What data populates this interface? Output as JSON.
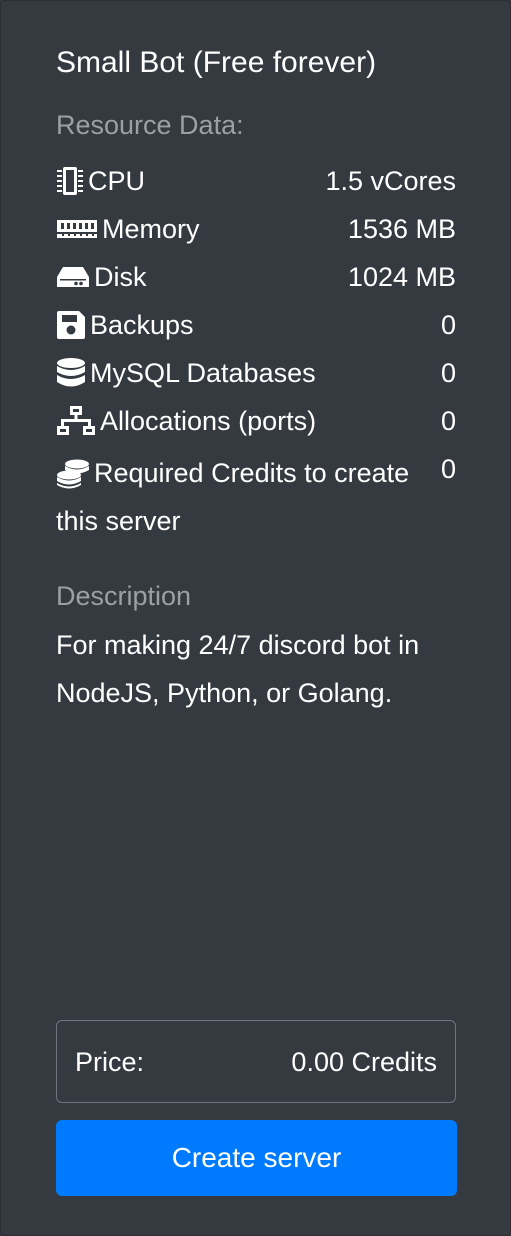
{
  "card": {
    "title": "Small Bot (Free forever)",
    "resource_label": "Resource Data:",
    "resources": [
      {
        "icon": "cpu-chip-icon",
        "name": "CPU",
        "value": "1.5 vCores"
      },
      {
        "icon": "memory-icon",
        "name": "Memory",
        "value": "1536 MB"
      },
      {
        "icon": "hdd-icon",
        "name": "Disk",
        "value": "1024 MB"
      },
      {
        "icon": "save-icon",
        "name": "Backups",
        "value": "0"
      },
      {
        "icon": "database-icon",
        "name": "MySQL Databases",
        "value": "0"
      },
      {
        "icon": "network-icon",
        "name": "Allocations (ports)",
        "value": "0"
      }
    ],
    "credits": {
      "icon": "coins-icon",
      "name": "Required Credits to create this server",
      "value": "0"
    },
    "description_label": "Description",
    "description": "For making 24/7 discord bot in NodeJS, Python, or Golang.",
    "price": {
      "label": "Price:",
      "amount": "0.00 Credits"
    },
    "create_button": "Create server"
  },
  "colors": {
    "background": "#343a40",
    "muted_text": "#9aa0a6",
    "primary": "#007bff",
    "border": "#6c757d"
  }
}
